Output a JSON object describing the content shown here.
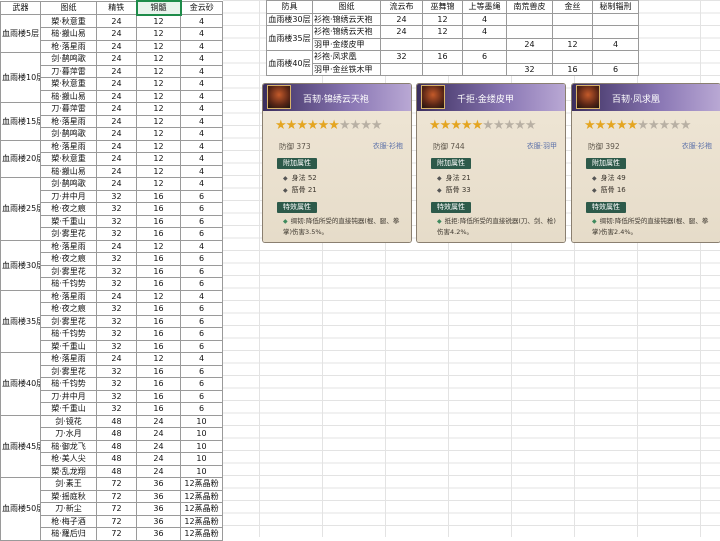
{
  "left_table": {
    "headers": [
      "武器",
      "图纸",
      "精铁",
      "铜髓",
      "金云砂"
    ],
    "groups": [
      {
        "floor": "血雨楼5层",
        "rows": [
          [
            "槊·秋意重",
            "24",
            "12",
            "4"
          ],
          [
            "槌·搬山易",
            "24",
            "12",
            "4"
          ],
          [
            "枪·落星雨",
            "24",
            "12",
            "4"
          ]
        ]
      },
      {
        "floor": "血雨楼10层",
        "rows": [
          [
            "剑·鹊鸣歌",
            "24",
            "12",
            "4"
          ],
          [
            "刀·暮萍雷",
            "24",
            "12",
            "4"
          ],
          [
            "槊·秋意重",
            "24",
            "12",
            "4"
          ],
          [
            "槌·搬山易",
            "24",
            "12",
            "4"
          ]
        ]
      },
      {
        "floor": "血雨楼15层",
        "rows": [
          [
            "刀·暮萍雷",
            "24",
            "12",
            "4"
          ],
          [
            "枪·落星雨",
            "24",
            "12",
            "4"
          ],
          [
            "剑·鹊鸣歌",
            "24",
            "12",
            "4"
          ]
        ]
      },
      {
        "floor": "血雨楼20层",
        "rows": [
          [
            "枪·落星雨",
            "24",
            "12",
            "4"
          ],
          [
            "槊·秋意重",
            "24",
            "12",
            "4"
          ],
          [
            "槌·搬山易",
            "24",
            "12",
            "4"
          ]
        ]
      },
      {
        "floor": "血雨楼25层",
        "rows": [
          [
            "剑·鹊鸣歌",
            "24",
            "12",
            "4"
          ],
          [
            "刀·井中月",
            "32",
            "16",
            "6"
          ],
          [
            "枪·夜之痕",
            "32",
            "16",
            "6"
          ],
          [
            "槊·千重山",
            "32",
            "16",
            "6"
          ],
          [
            "剑·雾里花",
            "32",
            "16",
            "6"
          ]
        ]
      },
      {
        "floor": "血雨楼30层",
        "rows": [
          [
            "枪·落星雨",
            "24",
            "12",
            "4"
          ],
          [
            "枪·夜之痕",
            "32",
            "16",
            "6"
          ],
          [
            "剑·雾里花",
            "32",
            "16",
            "6"
          ],
          [
            "槌·千钧势",
            "32",
            "16",
            "6"
          ]
        ]
      },
      {
        "floor": "血雨楼35层",
        "rows": [
          [
            "枪·落星雨",
            "24",
            "12",
            "4"
          ],
          [
            "枪·夜之痕",
            "32",
            "16",
            "6"
          ],
          [
            "剑·雾里花",
            "32",
            "16",
            "6"
          ],
          [
            "槌·千钧势",
            "32",
            "16",
            "6"
          ],
          [
            "槊·千重山",
            "32",
            "16",
            "6"
          ]
        ]
      },
      {
        "floor": "血雨楼40层",
        "rows": [
          [
            "枪·落星雨",
            "24",
            "12",
            "4"
          ],
          [
            "剑·雾里花",
            "32",
            "16",
            "6"
          ],
          [
            "槌·千钧势",
            "32",
            "16",
            "6"
          ],
          [
            "刀·井中月",
            "32",
            "16",
            "6"
          ],
          [
            "槊·千重山",
            "32",
            "16",
            "6"
          ]
        ]
      },
      {
        "floor": "血雨楼45层",
        "rows": [
          [
            "剑·镜花",
            "48",
            "24",
            "10"
          ],
          [
            "刀·水月",
            "48",
            "24",
            "10"
          ],
          [
            "槌·御龙飞",
            "48",
            "24",
            "10"
          ],
          [
            "枪·美人尖",
            "48",
            "24",
            "10"
          ],
          [
            "槊·乱龙翔",
            "48",
            "24",
            "10"
          ]
        ]
      },
      {
        "floor": "血雨楼50层",
        "rows": [
          [
            "剑·素王",
            "72",
            "36",
            "12蒸晶粉"
          ],
          [
            "槊·摇庭秋",
            "72",
            "36",
            "12蒸晶粉"
          ],
          [
            "刀·新尘",
            "72",
            "36",
            "12蒸晶粉"
          ],
          [
            "枪·梅子酒",
            "72",
            "36",
            "12蒸晶粉"
          ],
          [
            "槌·羅后归",
            "72",
            "36",
            "12蒸晶粉"
          ]
        ]
      }
    ]
  },
  "right_table": {
    "headers": [
      "防具",
      "图纸",
      "流云布",
      "巫舞锦",
      "上等墨绳",
      "南荒兽皮",
      "金丝",
      "秘制辎刑"
    ],
    "groups": [
      {
        "floor": "血雨楼30层",
        "rows": [
          [
            "衫袍·锦绣云天袍",
            "24",
            "12",
            "4",
            "",
            "",
            ""
          ]
        ]
      },
      {
        "floor": "血雨楼35层",
        "rows": [
          [
            "衫袍·锦绣云天袍",
            "24",
            "12",
            "4",
            "",
            "",
            ""
          ],
          [
            "羽甲·金缕皮甲",
            "",
            "",
            "",
            "24",
            "12",
            "4"
          ]
        ]
      },
      {
        "floor": "血雨楼40层",
        "rows": [
          [
            "衫袍·凤求凰",
            "32",
            "16",
            "6",
            "",
            "",
            ""
          ],
          [
            "羽甲·金丝铁木甲",
            "",
            "",
            "",
            "32",
            "16",
            "6"
          ]
        ]
      }
    ]
  },
  "cards": [
    {
      "name": "百韧·锦绣云天袍",
      "stars_on": 6,
      "stars_total": 10,
      "defense": "防御 373",
      "part": "衣服·衫袍",
      "tag_attr": "附加属性",
      "attrs": [
        "身法 52",
        "筋骨 21"
      ],
      "tag_effect": "特效属性",
      "effect": "绸韧:降低所受的直接钝器(棍、腿、拳掌)伤害3.5%。"
    },
    {
      "name": "千拒·金缕皮甲",
      "stars_on": 5,
      "stars_total": 10,
      "defense": "防御 744",
      "part": "衣服·羽甲",
      "tag_attr": "附加属性",
      "attrs": [
        "身法 21",
        "筋骨 33"
      ],
      "tag_effect": "特效属性",
      "effect": "抵拒:降低所受的直接锐器(刀、剑、枪)伤害4.2%。"
    },
    {
      "name": "百韧·凤求凰",
      "stars_on": 5,
      "stars_total": 10,
      "defense": "防御 392",
      "part": "衣服·衫袍",
      "tag_attr": "附加属性",
      "attrs": [
        "身法 49",
        "筋骨 16"
      ],
      "tag_effect": "特效属性",
      "effect": "绸韧:降低所受的直接钝器(棍、腿、拳掌)伤害2.4%。"
    }
  ]
}
